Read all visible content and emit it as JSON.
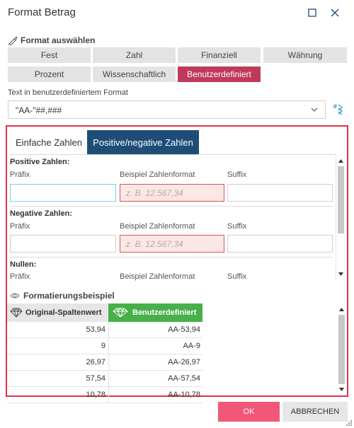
{
  "window": {
    "title": "Format Betrag",
    "maximize_icon": "square-icon",
    "close_icon": "close-icon"
  },
  "format_select": {
    "label": "Format auswählen",
    "icon": "ruler-pencil-icon",
    "buttons": [
      {
        "label": "Fest",
        "active": false
      },
      {
        "label": "Zahl",
        "active": false
      },
      {
        "label": "Finanziell",
        "active": false
      },
      {
        "label": "Währung",
        "active": false
      },
      {
        "label": "Prozent",
        "active": false
      },
      {
        "label": "Wissenschaftlich",
        "active": false
      },
      {
        "label": "Benutzerdefiniert",
        "active": true
      }
    ]
  },
  "custom_format": {
    "label": "Text in benutzerdefiniertem Format",
    "value": "\"AA-\"##,###",
    "wizard_icon": "format-wizard-icon"
  },
  "tabs": [
    {
      "label": "Einfache Zahlen",
      "active": false
    },
    {
      "label": "Positive/negative Zahlen",
      "active": true
    }
  ],
  "groups": [
    {
      "title": "Positive Zahlen:",
      "prefix_label": "Präfix",
      "example_label": "Beispiel Zahlenformat",
      "suffix_label": "Suffix",
      "example_placeholder": "z. B. 12.567,34"
    },
    {
      "title": "Negative Zahlen:",
      "prefix_label": "Präfix",
      "example_label": "Beispiel Zahlenformat",
      "suffix_label": "Suffix",
      "example_placeholder": "z. B. 12.567,34"
    },
    {
      "title": "Nullen:",
      "prefix_label": "Präfix",
      "example_label": "Beispiel Zahlenformat",
      "suffix_label": "Suffix"
    }
  ],
  "example": {
    "label": "Formatierungsbeispiel",
    "icon": "eye-icon",
    "col_original": "Original-Spaltenwert",
    "col_custom": "Benutzerdefiniert",
    "col_original_icon": "gem-outline-icon",
    "col_custom_icon": "diamond-icon",
    "rows": [
      {
        "original": "53,94",
        "custom": "AA-53,94"
      },
      {
        "original": "9",
        "custom": "AA-9"
      },
      {
        "original": "26,97",
        "custom": "AA-26,97"
      },
      {
        "original": "57,54",
        "custom": "AA-57,54"
      },
      {
        "original": "10,78",
        "custom": "AA-10,78"
      }
    ]
  },
  "footer": {
    "ok_label": "OK",
    "cancel_label": "ABBRECHEN"
  },
  "colors": {
    "active_format": "#c0395a",
    "active_tab": "#1e4d78",
    "panel_border": "#e0324a",
    "custom_header": "#48b04a",
    "ok_button": "#f0587a"
  }
}
